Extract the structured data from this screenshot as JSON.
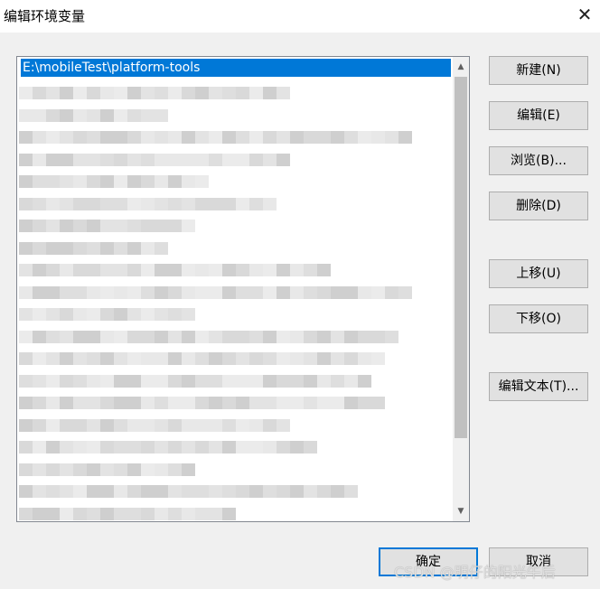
{
  "window": {
    "title": "编辑环境变量",
    "close_glyph": "✕"
  },
  "list": {
    "selected_item": "E:\\mobileTest\\platform-tools",
    "scroll_up_glyph": "▲",
    "scroll_down_glyph": "▼"
  },
  "buttons": {
    "new": "新建(N)",
    "edit": "编辑(E)",
    "browse": "浏览(B)...",
    "delete": "删除(D)",
    "move_up": "上移(U)",
    "move_down": "下移(O)",
    "edit_text": "编辑文本(T)...",
    "ok": "确定",
    "cancel": "取消"
  },
  "watermark": "CSDN @明仔的阳光午后",
  "colors": {
    "selection": "#0078d7",
    "background": "#f0f0f0"
  }
}
